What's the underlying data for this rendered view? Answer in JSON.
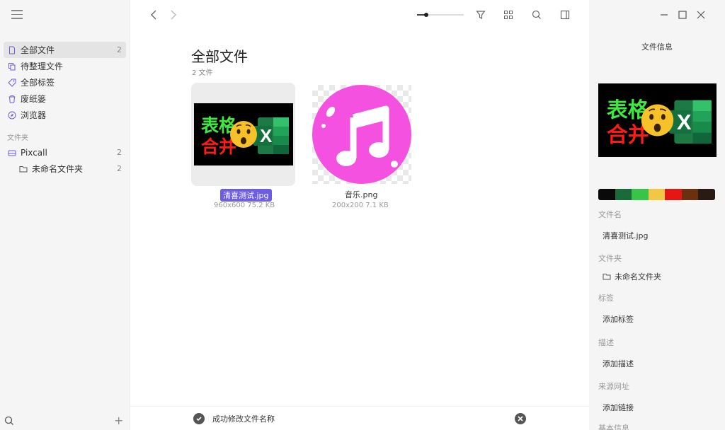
{
  "sidebar": {
    "nav": [
      {
        "label": "全部文件",
        "count": "2",
        "icon": "file-icon",
        "active": true
      },
      {
        "label": "待整理文件",
        "count": "",
        "icon": "copy-icon"
      },
      {
        "label": "全部标签",
        "count": "",
        "icon": "tag-icon"
      },
      {
        "label": "废纸篓",
        "count": "",
        "icon": "trash-icon"
      },
      {
        "label": "浏览器",
        "count": "",
        "icon": "compass-icon"
      }
    ],
    "section_label": "文件夹",
    "folders": [
      {
        "label": "Pixcall",
        "count": "2",
        "icon": "drive-icon"
      },
      {
        "label": "未命名文件夹",
        "count": "2",
        "icon": "folder-icon"
      }
    ],
    "add_symbol": "+"
  },
  "main": {
    "title": "全部文件",
    "subtitle": "2 文件",
    "files": [
      {
        "name": "清喜测试.jpg",
        "meta": "960x600  75.2 KB",
        "selected": true
      },
      {
        "name": "音乐.png",
        "meta": "200x200  7.1 KB",
        "selected": false
      }
    ],
    "thumb_text": {
      "line1": "表格",
      "line2": "合并",
      "excel_letter": "X",
      "emoji": "😲"
    },
    "status": "成功修改文件名称"
  },
  "right": {
    "title": "文件信息",
    "palette": [
      "#0a0a0a",
      "#1a6b3a",
      "#38c448",
      "#f2c744",
      "#e81515",
      "#6b3010",
      "#2a1a14"
    ],
    "fields": [
      {
        "label": "文件名",
        "value": "清喜测试.jpg"
      },
      {
        "label": "文件夹",
        "value": "未命名文件夹"
      },
      {
        "label": "标签",
        "value": "添加标签"
      },
      {
        "label": "描述",
        "value": "添加描述"
      },
      {
        "label": "来源网址",
        "value": "添加链接"
      },
      {
        "label": "基本信息",
        "value": ""
      }
    ]
  },
  "colors": {
    "accent": "#6c5ce7",
    "music_pink": "#f551e0"
  }
}
